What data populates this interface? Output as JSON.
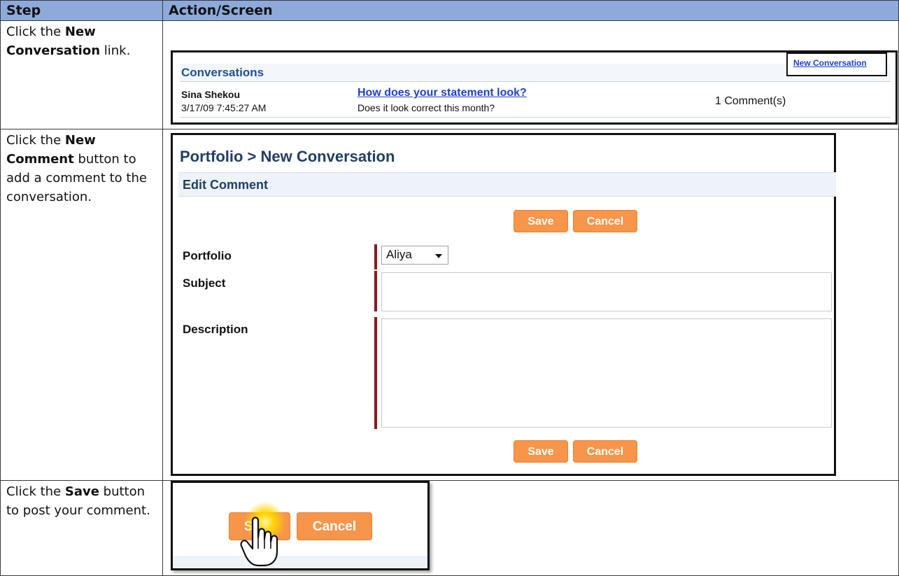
{
  "table": {
    "header_step": "Step",
    "header_action": "Action/Screen"
  },
  "rows": [
    {
      "pre": "Click the ",
      "bold": "New Conversation",
      "post": " link."
    },
    {
      "pre": "Click the ",
      "bold": "New Comment",
      "post": " button to add a comment to the conversation."
    },
    {
      "pre": "Click the ",
      "bold": "Save",
      "post": " button to post your comment."
    }
  ],
  "shot1": {
    "title": "Conversations",
    "new_link": "New Conversation",
    "author": "Sina Shekou",
    "date": "3/17/09 7:45:27 AM",
    "subject": "How does your statement look?",
    "description": "Does it look correct this month?",
    "comments": "1 Comment(s)"
  },
  "shot2": {
    "title": "Portfolio > New Conversation",
    "section": "Edit Comment",
    "save": "Save",
    "cancel": "Cancel",
    "portfolio_label": "Portfolio",
    "portfolio_value": "Aliya",
    "subject_label": "Subject",
    "description_label": "Description"
  },
  "shot3": {
    "save": "Save",
    "cancel": "Cancel"
  },
  "colors": {
    "header_bg": "#8eaadb",
    "button": "#f7954a",
    "link": "#1d3fcf",
    "title": "#1f3f66",
    "required_bar": "#8b1a1a"
  }
}
